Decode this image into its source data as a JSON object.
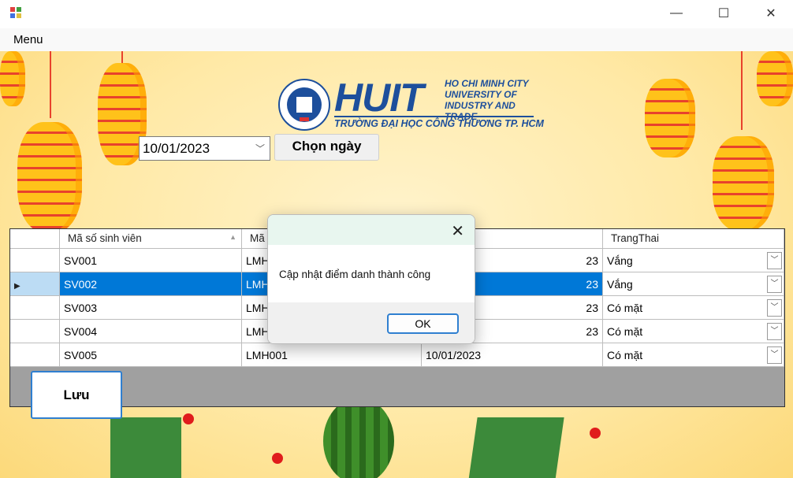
{
  "window": {
    "minimize": "—",
    "maximize": "☐",
    "close": "✕"
  },
  "menu": {
    "label": "Menu"
  },
  "logo": {
    "brand": "HUIT",
    "line1": "HO CHI MINH CITY",
    "line2": "UNIVERSITY OF",
    "line3": "INDUSTRY AND TRADE",
    "subtitle": "TRƯỜNG ĐẠI HỌC CÔNG THƯƠNG TP. HCM"
  },
  "date_picker": {
    "value": "10/01/2023"
  },
  "choose_date_button": "Chọn ngày",
  "grid": {
    "columns": [
      "Mã số sinh viên",
      "Mã L",
      "",
      "TrangThai"
    ],
    "rows": [
      {
        "mssv": "SV001",
        "ma": "LMH",
        "date": "23",
        "status": "Vắng"
      },
      {
        "mssv": "SV002",
        "ma": "LMH",
        "date": "23",
        "status": "Vắng"
      },
      {
        "mssv": "SV003",
        "ma": "LMH",
        "date": "23",
        "status": "Có mặt"
      },
      {
        "mssv": "SV004",
        "ma": "LMH",
        "date": "23",
        "status": "Có mặt"
      },
      {
        "mssv": "SV005",
        "ma": "LMH001",
        "date": "10/01/2023",
        "status": "Có mặt"
      }
    ]
  },
  "save_button": "Lưu",
  "dialog": {
    "message": "Cập nhật điểm danh thành công",
    "ok": "OK",
    "close": "✕"
  }
}
